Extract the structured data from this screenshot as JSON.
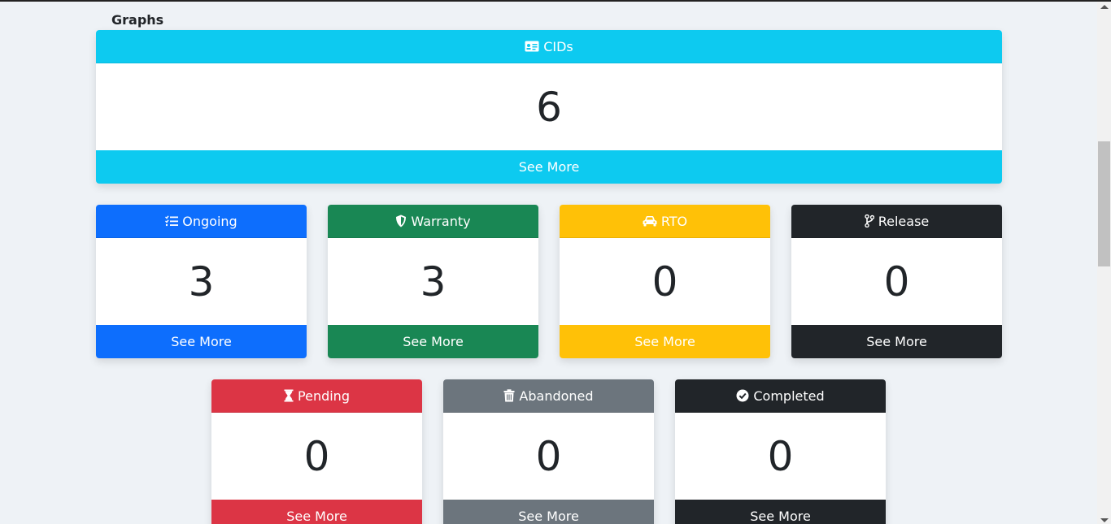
{
  "section_title": "Graphs",
  "colors": {
    "cyan": "#0dcaf0",
    "blue": "#0d6efd",
    "green": "#198754",
    "yellow": "#ffc107",
    "dark": "#212529",
    "red": "#dc3545",
    "gray": "#6c757d"
  },
  "cards": {
    "cids": {
      "title": "CIDs",
      "icon": "id-card-icon",
      "value": "6",
      "footer": "See More",
      "color": "#0dcaf0"
    },
    "ongoing": {
      "title": "Ongoing",
      "icon": "list-check-icon",
      "value": "3",
      "footer": "See More",
      "color": "#0d6efd"
    },
    "warranty": {
      "title": "Warranty",
      "icon": "shield-icon",
      "value": "3",
      "footer": "See More",
      "color": "#198754"
    },
    "rto": {
      "title": "RTO",
      "icon": "car-icon",
      "value": "0",
      "footer": "See More",
      "color": "#ffc107"
    },
    "release": {
      "title": "Release",
      "icon": "branch-icon",
      "value": "0",
      "footer": "See More",
      "color": "#212529"
    },
    "pending": {
      "title": "Pending",
      "icon": "hourglass-icon",
      "value": "0",
      "footer": "See More",
      "color": "#dc3545"
    },
    "abandoned": {
      "title": "Abandoned",
      "icon": "trash-icon",
      "value": "0",
      "footer": "See More",
      "color": "#6c757d"
    },
    "completed": {
      "title": "Completed",
      "icon": "check-circle-icon",
      "value": "0",
      "footer": "See More",
      "color": "#212529"
    }
  }
}
